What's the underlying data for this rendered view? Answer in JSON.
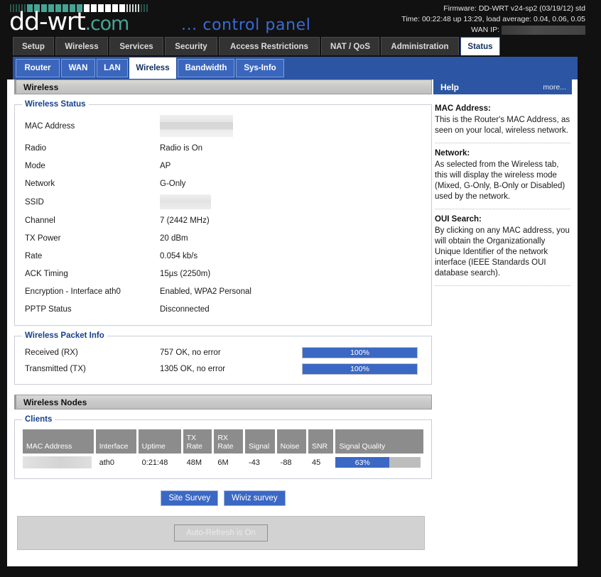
{
  "header": {
    "logo_main": "dd-wrt",
    "logo_suffix": ".com",
    "tagline": "... control panel",
    "firmware": "Firmware: DD-WRT v24-sp2 (03/19/12) std",
    "time": "Time: 00:22:48 up 13:29, load average: 0.04, 0.06, 0.05",
    "wan_ip_label": "WAN IP:",
    "wan_ip_value": ""
  },
  "primary_tabs": [
    {
      "label": "Setup",
      "active": false
    },
    {
      "label": "Wireless",
      "active": false
    },
    {
      "label": "Services",
      "active": false
    },
    {
      "label": "Security",
      "active": false
    },
    {
      "label": "Access Restrictions",
      "active": false
    },
    {
      "label": "NAT / QoS",
      "active": false
    },
    {
      "label": "Administration",
      "active": false
    },
    {
      "label": "Status",
      "active": true
    }
  ],
  "secondary_tabs": [
    {
      "label": "Router",
      "active": false
    },
    {
      "label": "WAN",
      "active": false
    },
    {
      "label": "LAN",
      "active": false
    },
    {
      "label": "Wireless",
      "active": true
    },
    {
      "label": "Bandwidth",
      "active": false
    },
    {
      "label": "Sys-Info",
      "active": false
    }
  ],
  "panels": {
    "wireless_title": "Wireless",
    "wireless_nodes_title": "Wireless Nodes"
  },
  "wireless_status": {
    "legend": "Wireless Status",
    "rows": [
      {
        "label": "MAC Address",
        "value": "",
        "redacted": "mac"
      },
      {
        "label": "Radio",
        "value": "Radio is On"
      },
      {
        "label": "Mode",
        "value": "AP"
      },
      {
        "label": "Network",
        "value": "G-Only"
      },
      {
        "label": "SSID",
        "value": "",
        "redacted": "ssid"
      },
      {
        "label": "Channel",
        "value": "7 (2442 MHz)"
      },
      {
        "label": "TX Power",
        "value": "20 dBm"
      },
      {
        "label": "Rate",
        "value": "0.054 kb/s"
      },
      {
        "label": "ACK Timing",
        "value": "15µs (2250m)"
      },
      {
        "label": "Encryption - Interface ath0",
        "value": "Enabled, WPA2 Personal"
      },
      {
        "label": "PPTP Status",
        "value": "Disconnected"
      }
    ]
  },
  "packet_info": {
    "legend": "Wireless Packet Info",
    "rows": [
      {
        "label": "Received (RX)",
        "value": "757 OK, no error",
        "percent": 100,
        "percent_label": "100%"
      },
      {
        "label": "Transmitted (TX)",
        "value": "1305 OK, no error",
        "percent": 100,
        "percent_label": "100%"
      }
    ]
  },
  "clients": {
    "legend": "Clients",
    "columns": [
      "MAC Address",
      "Interface",
      "Uptime",
      "TX\nRate",
      "RX\nRate",
      "Signal",
      "Noise",
      "SNR",
      "Signal Quality"
    ],
    "columns_display": [
      {
        "line1": "",
        "line2": "MAC Address"
      },
      {
        "line1": "",
        "line2": "Interface"
      },
      {
        "line1": "",
        "line2": "Uptime"
      },
      {
        "line1": "TX",
        "line2": "Rate"
      },
      {
        "line1": "RX",
        "line2": "Rate"
      },
      {
        "line1": "",
        "line2": "Signal"
      },
      {
        "line1": "",
        "line2": "Noise"
      },
      {
        "line1": "",
        "line2": "SNR"
      },
      {
        "line1": "",
        "line2": "Signal Quality"
      }
    ],
    "rows": [
      {
        "mac": "",
        "interface": "ath0",
        "uptime": "0:21:48",
        "tx_rate": "48M",
        "rx_rate": "6M",
        "signal": "-43",
        "noise": "-88",
        "snr": "45",
        "signal_quality_percent": 63,
        "signal_quality_label": "63%"
      }
    ]
  },
  "buttons": {
    "site_survey": "Site Survey",
    "wiviz_survey": "Wiviz survey",
    "auto_refresh": "Auto-Refresh is On"
  },
  "help": {
    "title": "Help",
    "more": "more...",
    "entries": [
      {
        "heading": "MAC Address:",
        "text": "This is the Router's MAC Address, as seen on your local, wireless network."
      },
      {
        "heading": "Network:",
        "text": "As selected from the Wireless tab, this will display the wireless mode (Mixed, G-Only, B-Only or Disabled) used by the network."
      },
      {
        "heading": "OUI Search:",
        "text": "By clicking on any MAC address, you will obtain the Organizationally Unique Identifier of the network interface (IEEE Standards OUI database search)."
      }
    ]
  },
  "colors": {
    "accent_blue": "#2c55a4",
    "bar_blue": "#3b68c4",
    "logo_teal": "#46a394",
    "page_black": "#111111"
  }
}
